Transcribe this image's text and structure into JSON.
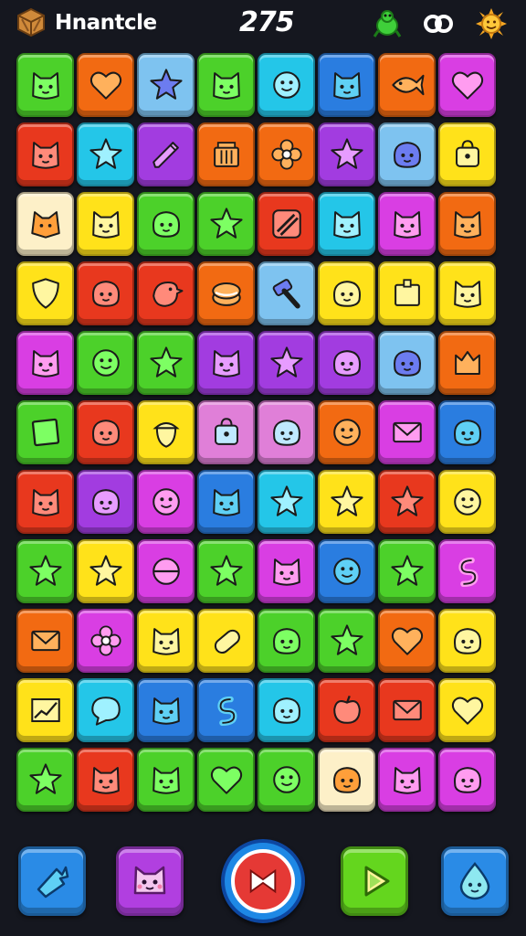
{
  "header": {
    "title": "Hnantcle",
    "score": "275",
    "logo_icon": "crate-icon",
    "right_icons": [
      "bug-icon",
      "swirl-icon",
      "sun-icon"
    ]
  },
  "colors": {
    "background": "#15171f",
    "green": "#4cd12a",
    "orange": "#f26a12",
    "lightblue": "#7ec3f0",
    "purple": "#a23ce0",
    "cyan": "#24c6e8",
    "blue": "#2a7de0",
    "yellow": "#ffe21a",
    "red": "#e8381e",
    "magenta": "#d93ee3",
    "cream": "#fdf0c8",
    "pink": "#e07fd8"
  },
  "board": {
    "rows": 11,
    "cols": 8,
    "tiles": [
      [
        [
          "green",
          "cat-face-icon"
        ],
        [
          "orange",
          "heart-icon"
        ],
        [
          "lightblue",
          "star-icon"
        ],
        [
          "green",
          "cat-face-icon"
        ],
        [
          "cyan",
          "smile-face-icon"
        ],
        [
          "blue",
          "cat-face-icon"
        ],
        [
          "orange",
          "fish-icon"
        ],
        [
          "magenta",
          "heart-icon"
        ]
      ],
      [
        [
          "red",
          "cat-face-icon"
        ],
        [
          "cyan",
          "star-icon"
        ],
        [
          "purple",
          "pencil-icon"
        ],
        [
          "orange",
          "basket-icon"
        ],
        [
          "orange",
          "flower-icon"
        ],
        [
          "purple",
          "star-icon"
        ],
        [
          "lightblue",
          "blob-face-icon"
        ],
        [
          "yellow",
          "bag-icon"
        ]
      ],
      [
        [
          "cream",
          "fox-icon"
        ],
        [
          "yellow",
          "cat-face-icon"
        ],
        [
          "green",
          "blob-face-icon"
        ],
        [
          "green",
          "star-icon"
        ],
        [
          "red",
          "stripes-icon"
        ],
        [
          "cyan",
          "cat-face-icon"
        ],
        [
          "magenta",
          "cat-face-icon"
        ],
        [
          "orange",
          "cat-face-icon"
        ]
      ],
      [
        [
          "yellow",
          "shield-icon"
        ],
        [
          "red",
          "blob-face-icon"
        ],
        [
          "red",
          "bird-icon"
        ],
        [
          "orange",
          "cake-icon"
        ],
        [
          "lightblue",
          "hammer-icon"
        ],
        [
          "yellow",
          "blob-face-icon"
        ],
        [
          "yellow",
          "box-icon"
        ],
        [
          "yellow",
          "cat-face-icon"
        ]
      ],
      [
        [
          "magenta",
          "cat-face-icon"
        ],
        [
          "green",
          "smile-face-icon"
        ],
        [
          "green",
          "star-icon"
        ],
        [
          "purple",
          "cat-face-icon"
        ],
        [
          "purple",
          "star-icon"
        ],
        [
          "purple",
          "blob-face-icon"
        ],
        [
          "lightblue",
          "blob-face-icon"
        ],
        [
          "orange",
          "tulip-icon"
        ]
      ],
      [
        [
          "green",
          "square-icon"
        ],
        [
          "red",
          "blob-face-icon"
        ],
        [
          "yellow",
          "acorn-icon"
        ],
        [
          "pink",
          "bag-icon"
        ],
        [
          "pink",
          "blob-face-icon"
        ],
        [
          "orange",
          "smile-face-icon"
        ],
        [
          "magenta",
          "envelope-icon"
        ],
        [
          "blue",
          "blob-face-icon"
        ]
      ],
      [
        [
          "red",
          "cat-face-icon"
        ],
        [
          "purple",
          "blob-face-icon"
        ],
        [
          "magenta",
          "smile-face-icon"
        ],
        [
          "blue",
          "cat-face-icon"
        ],
        [
          "cyan",
          "star-icon"
        ],
        [
          "yellow",
          "star-icon"
        ],
        [
          "red",
          "star-icon"
        ],
        [
          "yellow",
          "smile-face-icon"
        ]
      ],
      [
        [
          "green",
          "star-icon"
        ],
        [
          "yellow",
          "star-icon"
        ],
        [
          "magenta",
          "bowl-icon"
        ],
        [
          "green",
          "star-icon"
        ],
        [
          "magenta",
          "cat-face-icon"
        ],
        [
          "blue",
          "smile-face-icon"
        ],
        [
          "green",
          "star-icon"
        ],
        [
          "magenta",
          "swirl-icon"
        ]
      ],
      [
        [
          "orange",
          "envelope-icon"
        ],
        [
          "magenta",
          "flower-icon"
        ],
        [
          "yellow",
          "cat-face-icon"
        ],
        [
          "yellow",
          "capsule-icon"
        ],
        [
          "green",
          "blob-face-icon"
        ],
        [
          "green",
          "star-icon"
        ],
        [
          "orange",
          "heart-icon"
        ],
        [
          "yellow",
          "blob-face-icon"
        ]
      ],
      [
        [
          "yellow",
          "chart-icon"
        ],
        [
          "cyan",
          "chat-bubble-icon"
        ],
        [
          "blue",
          "cat-face-icon"
        ],
        [
          "blue",
          "swirl-icon"
        ],
        [
          "cyan",
          "blob-face-icon"
        ],
        [
          "red",
          "apple-icon"
        ],
        [
          "red",
          "envelope-icon"
        ],
        [
          "yellow",
          "heart-icon"
        ]
      ],
      [
        [
          "green",
          "star-icon"
        ],
        [
          "red",
          "cat-face-icon"
        ],
        [
          "green",
          "cat-face-icon"
        ],
        [
          "green",
          "heart-icon"
        ],
        [
          "green",
          "smile-face-icon"
        ],
        [
          "cream",
          "blob-face-icon"
        ],
        [
          "magenta",
          "cat-face-icon"
        ],
        [
          "magenta",
          "blob-face-icon"
        ]
      ]
    ]
  },
  "footer": {
    "buttons": [
      {
        "name": "hint-button",
        "icon": "pointer-icon",
        "color": "blue"
      },
      {
        "name": "pet-button",
        "icon": "cat-face-icon",
        "color": "purple"
      },
      {
        "name": "pause-button",
        "icon": "bowtie-icon",
        "color": "red"
      },
      {
        "name": "play-button",
        "icon": "play-icon",
        "color": "green"
      },
      {
        "name": "helper-button",
        "icon": "drop-face-icon",
        "color": "blue"
      }
    ]
  }
}
